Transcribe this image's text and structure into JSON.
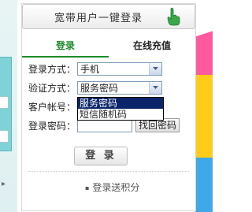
{
  "broadband_button": {
    "label": "宽带用户一键登录",
    "icon": "hand-pointer-icon"
  },
  "tabs": [
    {
      "label": "登录",
      "active": true
    },
    {
      "label": "在线充值",
      "active": false
    }
  ],
  "form": {
    "login_method": {
      "label": "登录方式：",
      "value": "手机"
    },
    "verify_method": {
      "label": "验证方式：",
      "value": "服务密码",
      "options": [
        "服务密码",
        "短信随机码"
      ],
      "highlighted": "服务密码"
    },
    "account": {
      "label": "客户帐号："
    },
    "password": {
      "label": "登录密码：",
      "find_button": "找回密码"
    },
    "login_button": "登 录"
  },
  "promo": "登录送积分",
  "colors": {
    "tab_active": "#1d8a2c",
    "highlight": "#0a246a"
  }
}
